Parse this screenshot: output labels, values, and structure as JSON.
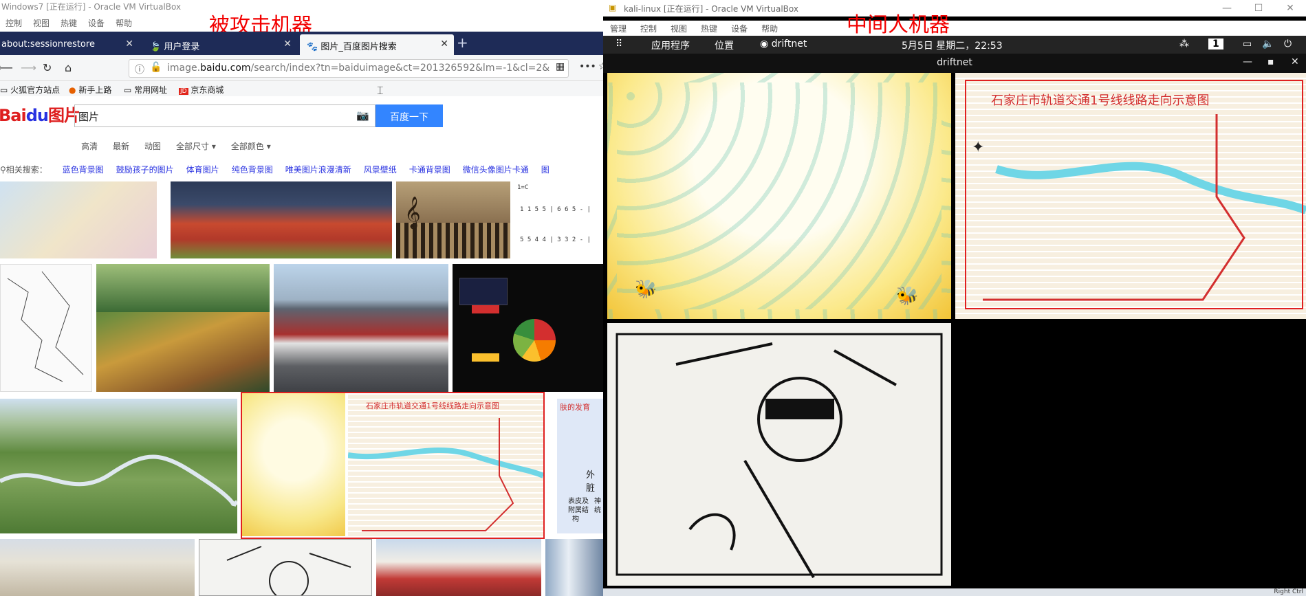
{
  "left": {
    "title": "Windows7 [正在运行] - Oracle VM VirtualBox",
    "menu": [
      "控制",
      "视图",
      "热键",
      "设备",
      "帮助"
    ],
    "annotation": "被攻击机器",
    "tabs": [
      {
        "label": "about:sessionrestore"
      },
      {
        "label": "用户登录"
      },
      {
        "label": "图片_百度图片搜索"
      }
    ],
    "url_prefix": "image.",
    "url_domain": "baidu.com",
    "url_rest": "/search/index?tn=baiduimage&ct=201326592&lm=-1&cl=2&",
    "bookmarks": [
      "火狐官方站点",
      "新手上路",
      "常用网址",
      "京东商城"
    ],
    "logo_a": "Bai",
    "logo_b": "du",
    "logo_c": "图片",
    "search_value": "图片",
    "search_button": "百度一下",
    "filters": [
      "高清",
      "最新",
      "动图",
      "全部尺寸 ▾",
      "全部颜色 ▾"
    ],
    "related_label": "相关搜索：",
    "related": [
      "蓝色背景图",
      "鼓励孩子的图片",
      "体育图片",
      "纯色背景图",
      "唯美图片浪漫清新",
      "风景壁纸",
      "卡通背景图",
      "微信头像图片卡通",
      "图"
    ],
    "map_caption": "石家庄市轨道交通1号线线路走向示意图",
    "sheet_key": "1=C",
    "sheet_row1": "1 1 5 5 | 6 6 5 - |",
    "sheet_row2": "5 5 4 4 | 3 3 2 - |",
    "edu_text": "外脏",
    "edu_sub1": "表皮及",
    "edu_sub2": "附属结",
    "edu_sub3": "构",
    "edu_sub4": "神",
    "edu_sub5": "统",
    "edu_header": "肤的发育"
  },
  "right": {
    "title": "kali-linux [正在运行] - Oracle VM VirtualBox",
    "menu": [
      "管理",
      "控制",
      "视图",
      "热键",
      "设备",
      "帮助"
    ],
    "annotation": "中间人机器",
    "apps": "应用程序",
    "places": "位置",
    "app_name": "driftnet",
    "clock": "5月5日 星期二，22:53",
    "workspace": "1",
    "window_title": "driftnet",
    "map_caption": "石家庄市轨道交通1号线线路走向示意图",
    "status_text": "Right Ctrl"
  },
  "colors": {
    "annotation": "#f20000",
    "tabbar": "#1e2b57",
    "baidu_blue": "#3385ff",
    "highlight": "#e02020"
  }
}
